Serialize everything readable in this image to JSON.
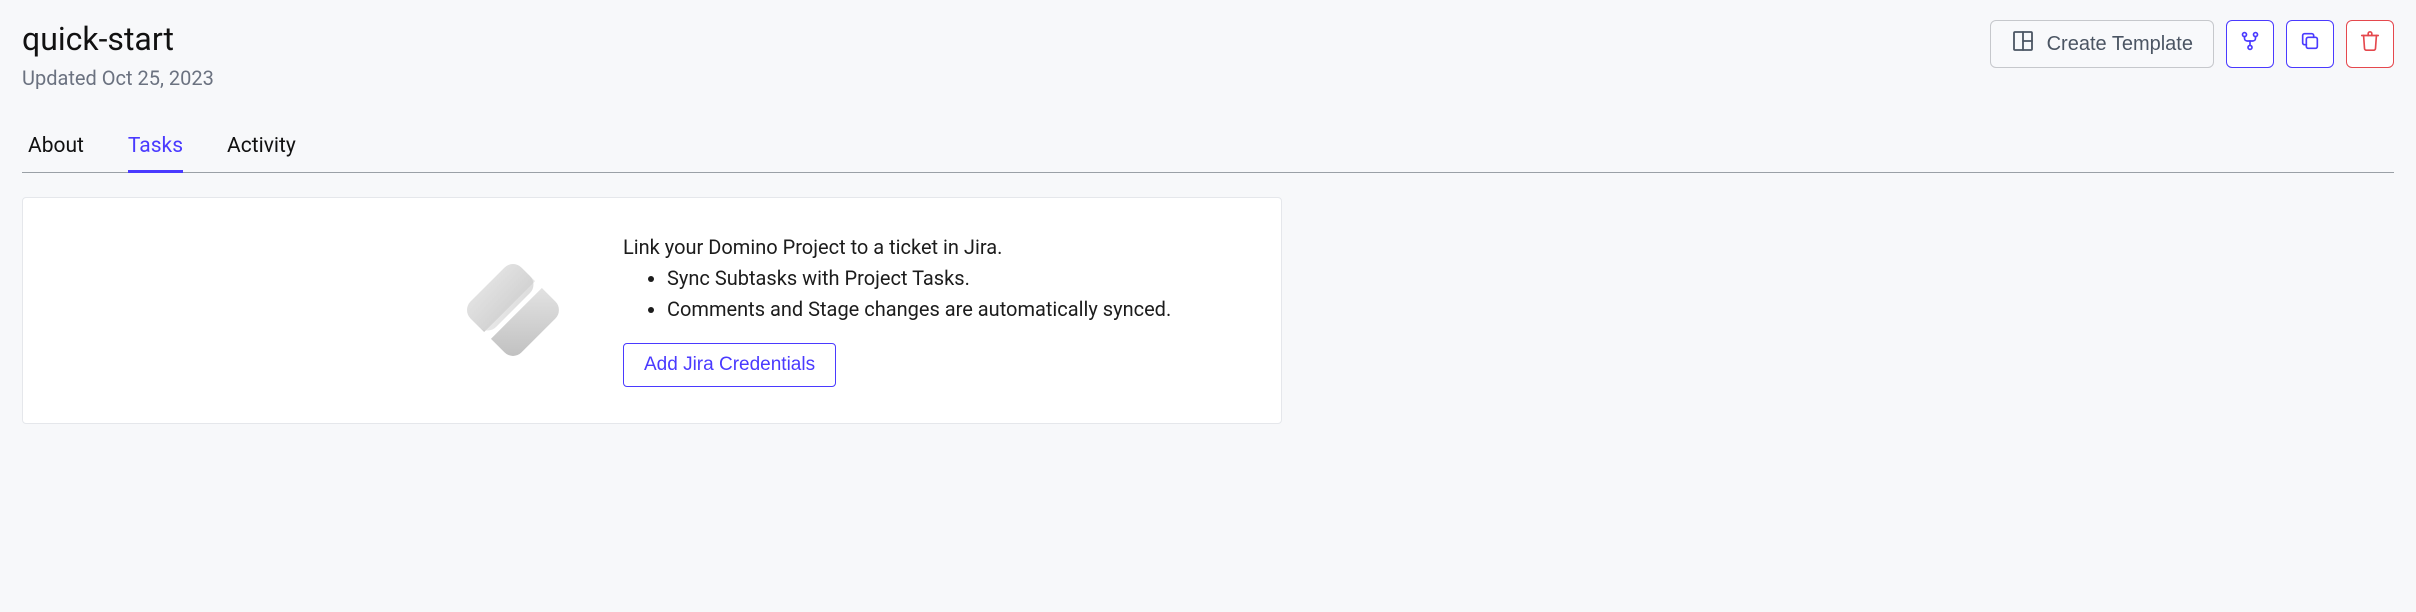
{
  "header": {
    "title": "quick-start",
    "updated": "Updated Oct 25, 2023"
  },
  "toolbar": {
    "create_template_label": "Create Template"
  },
  "tabs": [
    {
      "label": "About",
      "active": false
    },
    {
      "label": "Tasks",
      "active": true
    },
    {
      "label": "Activity",
      "active": false
    }
  ],
  "panel": {
    "heading": "Link your Domino Project to a ticket in Jira.",
    "bullets": [
      "Sync Subtasks with Project Tasks.",
      "Comments and Stage changes are automatically synced."
    ],
    "cta_label": "Add Jira Credentials"
  }
}
